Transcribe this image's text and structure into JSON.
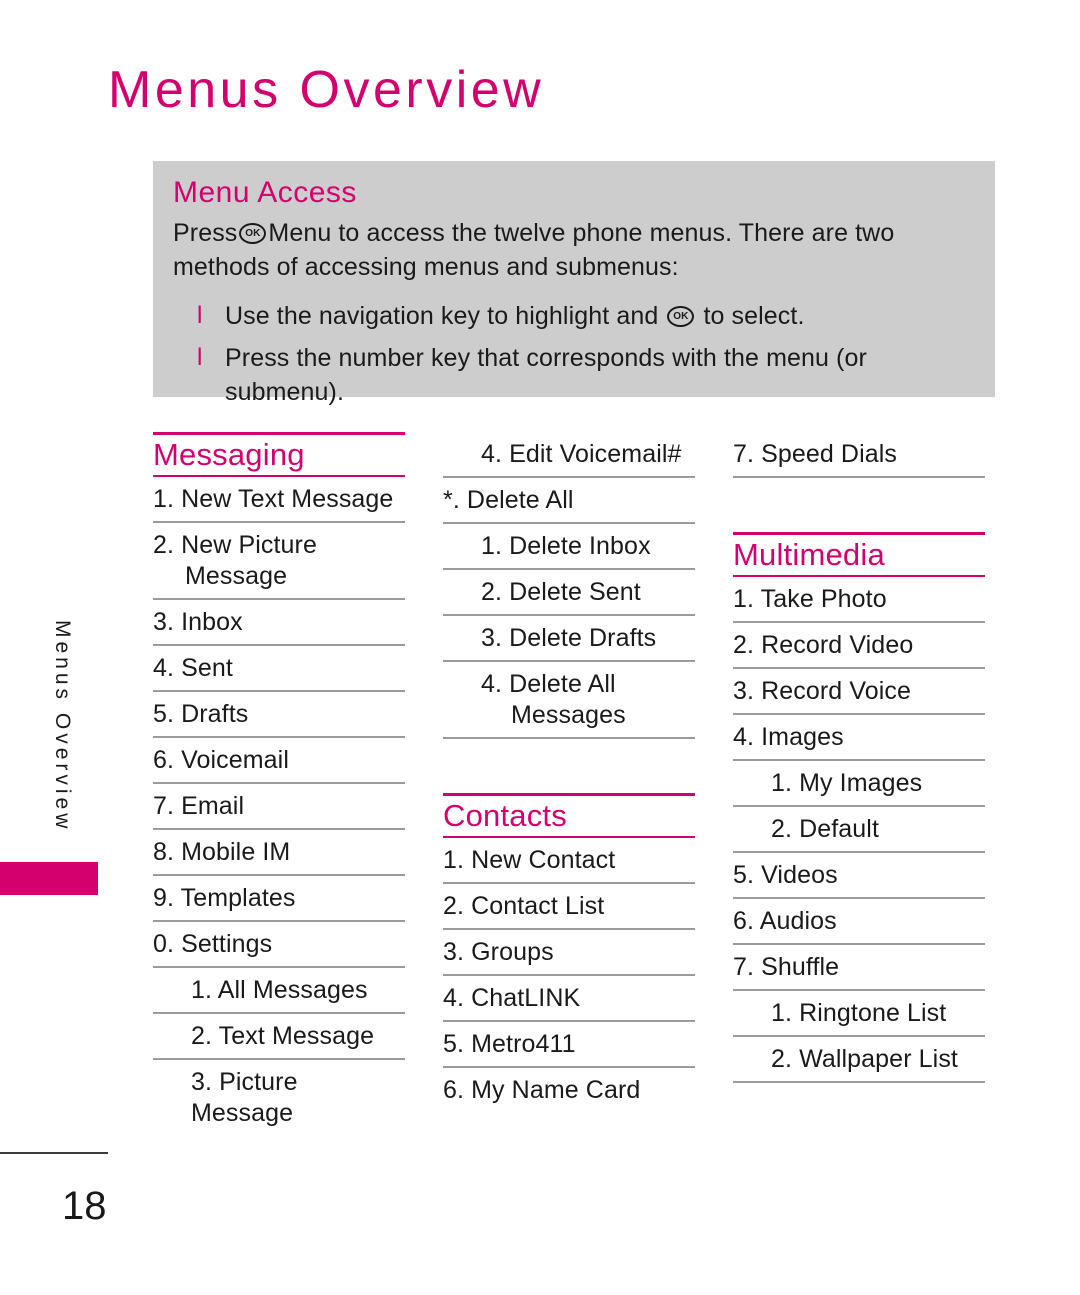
{
  "page": {
    "title": "Menus Overview",
    "side_tab_label": "Menus Overview",
    "page_number": "18"
  },
  "info_box": {
    "heading": "Menu Access",
    "paragraph_before_key": "Press",
    "key_label": "OK",
    "paragraph_after_key": "Menu to access the twelve phone menus. There are two methods of accessing menus and submenus:",
    "bullet_marker": "l",
    "bullets": [
      {
        "before_key": "Use the navigation key to highlight and",
        "key_label": "OK",
        "after_key": "to select."
      },
      {
        "before_key": "Press the number key that corresponds with the menu (or submenu).",
        "key_label": "",
        "after_key": ""
      }
    ]
  },
  "columns": [
    {
      "section": "Messaging",
      "items": [
        {
          "text": "1. New Text Message",
          "sub": false,
          "rule": true
        },
        {
          "text": "2. New Picture",
          "text2": "Message",
          "sub": false,
          "rule": true
        },
        {
          "text": "3. Inbox",
          "sub": false,
          "rule": true
        },
        {
          "text": "4. Sent",
          "sub": false,
          "rule": true
        },
        {
          "text": "5. Drafts",
          "sub": false,
          "rule": true
        },
        {
          "text": "6. Voicemail",
          "sub": false,
          "rule": true
        },
        {
          "text": "7. Email",
          "sub": false,
          "rule": true
        },
        {
          "text": "8.  Mobile IM",
          "sub": false,
          "rule": true
        },
        {
          "text": "9. Templates",
          "sub": false,
          "rule": true
        },
        {
          "text": "0. Settings",
          "sub": false,
          "rule": true
        },
        {
          "text": "1. All Messages",
          "sub": true,
          "rule": true
        },
        {
          "text": "2. Text Message",
          "sub": true,
          "rule": true
        },
        {
          "text": "3. Picture Message",
          "sub": true,
          "rule": false
        }
      ]
    },
    {
      "section2": "Contacts",
      "items_top": [
        {
          "text": "4. Edit Voicemail#",
          "sub": true,
          "rule": true
        },
        {
          "text": "*. Delete All",
          "sub": false,
          "rule": true
        },
        {
          "text": "1. Delete Inbox",
          "sub": true,
          "rule": true
        },
        {
          "text": "2. Delete Sent",
          "sub": true,
          "rule": true
        },
        {
          "text": "3. Delete Drafts",
          "sub": true,
          "rule": true
        },
        {
          "text": "4. Delete All",
          "text2": "Messages",
          "sub": true,
          "rule": true
        }
      ],
      "items_bottom": [
        {
          "text": "1. New Contact",
          "sub": false,
          "rule": true
        },
        {
          "text": "2. Contact List",
          "sub": false,
          "rule": true
        },
        {
          "text": "3. Groups",
          "sub": false,
          "rule": true
        },
        {
          "text": "4. ChatLINK",
          "sub": false,
          "rule": true
        },
        {
          "text": "5. Metro411",
          "sub": false,
          "rule": true
        },
        {
          "text": "6. My Name Card",
          "sub": false,
          "rule": false
        }
      ]
    },
    {
      "section3": "Multimedia",
      "items_top": [
        {
          "text": "7.  Speed Dials",
          "sub": false,
          "rule": true
        }
      ],
      "items_bottom": [
        {
          "text": "1. Take Photo",
          "sub": false,
          "rule": true
        },
        {
          "text": "2.  Record Video",
          "sub": false,
          "rule": true
        },
        {
          "text": "3.  Record Voice",
          "sub": false,
          "rule": true
        },
        {
          "text": "4. Images",
          "sub": false,
          "rule": true
        },
        {
          "text": "1. My Images",
          "sub": true,
          "rule": true
        },
        {
          "text": "2. Default",
          "sub": true,
          "rule": true
        },
        {
          "text": "5.  Videos",
          "sub": false,
          "rule": true
        },
        {
          "text": "6.  Audios",
          "sub": false,
          "rule": true
        },
        {
          "text": "7.  Shuffle",
          "sub": false,
          "rule": true
        },
        {
          "text": "1. Ringtone List",
          "sub": true,
          "rule": true
        },
        {
          "text": "2. Wallpaper List",
          "sub": true,
          "rule": true
        }
      ]
    }
  ],
  "colors": {
    "accent": "#d4006e",
    "box_background": "#cdcdcd",
    "rule": "#9a9a9a",
    "text": "#1a1a1a"
  }
}
